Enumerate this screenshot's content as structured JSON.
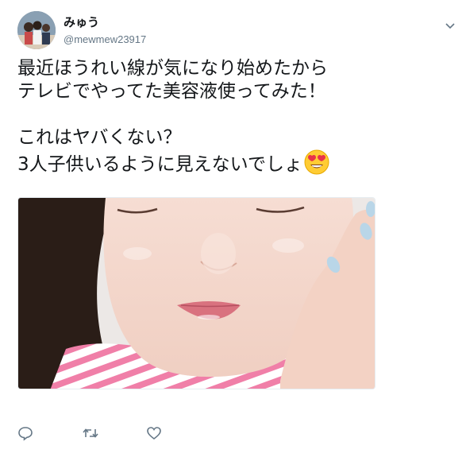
{
  "user": {
    "display_name": "みゅう",
    "handle": "@mewmew23917"
  },
  "tweet": {
    "lines": [
      "最近ほうれい線が気になり始めたから",
      "テレビでやってた美容液使ってみた！",
      "これはヤバくない？",
      "3人子供いるように見えないでしょ"
    ],
    "emoji": "heart-eyes-emoji"
  },
  "icons": {
    "more": "chevron-down-icon",
    "reply": "reply-icon",
    "retweet": "retweet-icon",
    "like": "heart-icon"
  },
  "colors": {
    "text": "#14171a",
    "secondary": "#657786",
    "pink_stripe": "#f07fa8"
  }
}
